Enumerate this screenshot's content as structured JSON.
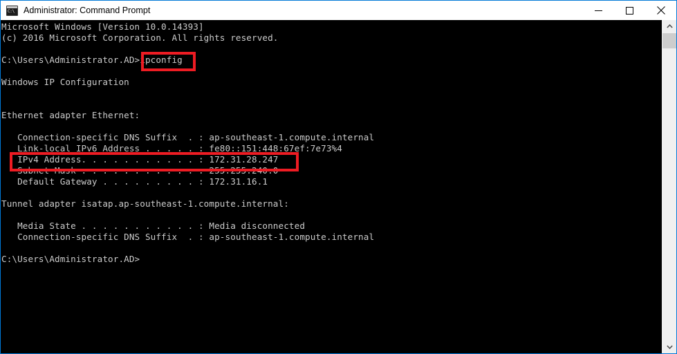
{
  "window": {
    "title": "Administrator: Command Prompt",
    "icon": "console-icon",
    "icon_prompt": "C:\\",
    "accent_color": "#0078d7",
    "titlebar_bg": "#ffffff",
    "console_bg": "#000000",
    "console_fg": "#cccccc",
    "highlight_color": "#ee1c23"
  },
  "controls": {
    "minimize": "minimize-button",
    "maximize": "maximize-button",
    "close": "close-button"
  },
  "console": {
    "lines": [
      "Microsoft Windows [Version 10.0.14393]",
      "(c) 2016 Microsoft Corporation. All rights reserved.",
      "",
      "C:\\Users\\Administrator.AD>ipconfig",
      "",
      "Windows IP Configuration",
      "",
      "",
      "Ethernet adapter Ethernet:",
      "",
      "   Connection-specific DNS Suffix  . : ap-southeast-1.compute.internal",
      "   Link-local IPv6 Address . . . . . : fe80::151:448:67ef:7e73%4",
      "   IPv4 Address. . . . . . . . . . . : 172.31.28.247",
      "   Subnet Mask . . . . . . . . . . . : 255.255.240.0",
      "   Default Gateway . . . . . . . . . : 172.31.16.1",
      "",
      "Tunnel adapter isatap.ap-southeast-1.compute.internal:",
      "",
      "   Media State . . . . . . . . . . . : Media disconnected",
      "   Connection-specific DNS Suffix  . : ap-southeast-1.compute.internal",
      "",
      "C:\\Users\\Administrator.AD>"
    ],
    "full_text": "Microsoft Windows [Version 10.0.14393]\n(c) 2016 Microsoft Corporation. All rights reserved.\n\nC:\\Users\\Administrator.AD>ipconfig\n\nWindows IP Configuration\n\n\nEthernet adapter Ethernet:\n\n   Connection-specific DNS Suffix  . : ap-southeast-1.compute.internal\n   Link-local IPv6 Address . . . . . : fe80::151:448:67ef:7e73%4\n   IPv4 Address. . . . . . . . . . . : 172.31.28.247\n   Subnet Mask . . . . . . . . . . . : 255.255.240.0\n   Default Gateway . . . . . . . . . : 172.31.16.1\n\nTunnel adapter isatap.ap-southeast-1.compute.internal:\n\n   Media State . . . . . . . . . . . : Media disconnected\n   Connection-specific DNS Suffix  . : ap-southeast-1.compute.internal\n\nC:\\Users\\Administrator.AD>",
    "os_version": "10.0.14393",
    "copyright_year": "2016",
    "prompt_path": "C:\\Users\\Administrator.AD>",
    "command": "ipconfig",
    "ethernet": {
      "adapter_name": "Ethernet adapter Ethernet:",
      "dns_suffix": "ap-southeast-1.compute.internal",
      "ipv6_link_local": "fe80::151:448:67ef:7e73%4",
      "ipv4_address": "172.31.28.247",
      "subnet_mask": "255.255.240.0",
      "default_gateway": "172.31.16.1"
    },
    "tunnel": {
      "adapter_name": "Tunnel adapter isatap.ap-southeast-1.compute.internal:",
      "media_state": "Media disconnected",
      "dns_suffix": "ap-southeast-1.compute.internal"
    }
  },
  "highlights": [
    {
      "name": "ipconfig-command",
      "text": "ipconfig"
    },
    {
      "name": "ipv4-address-line",
      "text": "IPv4 Address. . . . . . . . . . . : 172.31.28.247"
    }
  ],
  "scrollbar": {
    "up_arrow": "chevron-up-icon",
    "down_arrow": "chevron-down-icon",
    "thumb": "scrollbar-thumb"
  }
}
